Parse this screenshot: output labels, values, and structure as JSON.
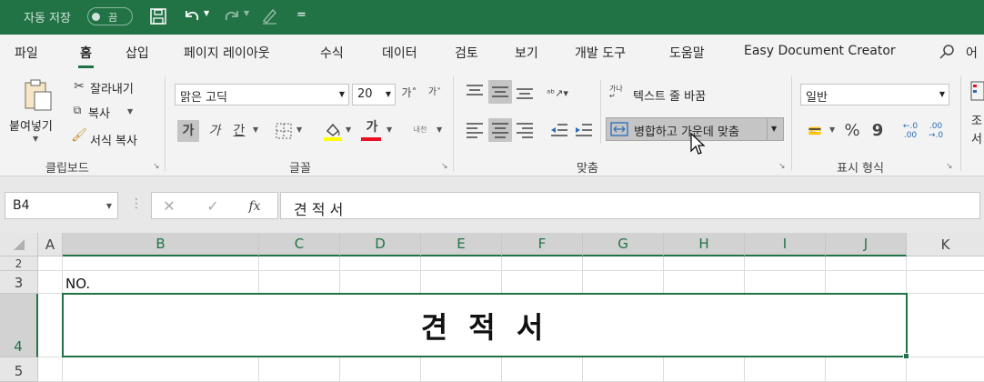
{
  "titlebar": {
    "autosave_label": "자동 저장",
    "autosave_state": "끔",
    "more": "="
  },
  "tabs": [
    "파일",
    "홈",
    "삽입",
    "페이지 레이아웃",
    "수식",
    "데이터",
    "검토",
    "보기",
    "개발 도구",
    "도움말",
    "Easy Document Creator",
    "어"
  ],
  "clipboard": {
    "paste": "붙여넣기",
    "cut": "잘라내기",
    "copy": "복사",
    "format_painter": "서식 복사",
    "group": "클립보드"
  },
  "font": {
    "name": "맑은 고딕",
    "size": "20",
    "bold": "가",
    "italic": "가",
    "underline": "간",
    "hangul_char": "내천",
    "font_color_glyph": "가",
    "group": "글꼴"
  },
  "alignment": {
    "wrap": "텍스트 줄 바꿈",
    "merge_center": "병합하고 가운데 맞춤",
    "group": "맞춤"
  },
  "number": {
    "format": "일반",
    "percent": "%",
    "comma": "9",
    "inc": "←.0 .00",
    "dec": ".00 →.0",
    "group": "표시 형식"
  },
  "styles": {
    "partial": "조 서"
  },
  "formula_bar": {
    "name_box": "B4",
    "fx": "fx",
    "content": "견 적 서"
  },
  "grid": {
    "columns": [
      "A",
      "B",
      "C",
      "D",
      "E",
      "F",
      "G",
      "H",
      "I",
      "J",
      "K"
    ],
    "rows": [
      "2",
      "3",
      "4",
      "5"
    ],
    "cells": {
      "A3_B3": "NO.",
      "merged_B4_J4": "견 적 서"
    }
  },
  "colors": {
    "accent": "#217346",
    "font_red": "#e81123",
    "fill_yellow": "#ffff00"
  }
}
